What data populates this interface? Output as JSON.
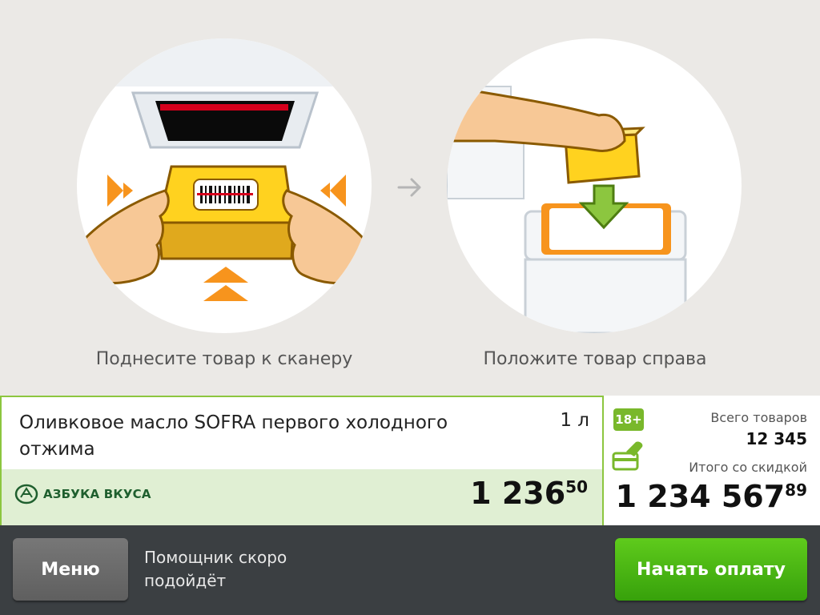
{
  "steps": {
    "step1_caption": "Поднесите товар к сканеру",
    "step2_caption": "Положите товар справа"
  },
  "product": {
    "name": "Оливковое масло SOFRA первого холодного отжима",
    "quantity": "1 л",
    "brand": "АЗБУКА ВКУСА",
    "price_main": "1 236",
    "price_cents": "50"
  },
  "summary": {
    "age_badge": "18+",
    "total_items_label": "Всего товаров",
    "total_items_value": "12 345",
    "total_sum_label": "Итого со скидкой",
    "total_sum_main": "1 234 567",
    "total_sum_cents": "89"
  },
  "footer": {
    "menu_label": "Меню",
    "helper_text": "Помощник скоро подойдёт",
    "pay_label": "Начать оплату"
  },
  "colors": {
    "accent_green": "#8cc63f",
    "pay_green": "#4bb515",
    "badge_green": "#79b82b",
    "arrow_orange": "#f7941d",
    "bottom_bar": "#3b3f42"
  }
}
